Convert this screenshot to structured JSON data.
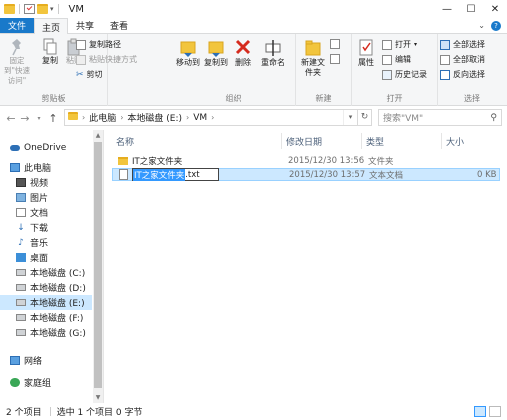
{
  "window": {
    "title": "VM"
  },
  "tabs": [
    {
      "label": "文件"
    },
    {
      "label": "主页"
    },
    {
      "label": "共享"
    },
    {
      "label": "查看"
    }
  ],
  "ribbon": {
    "clipboard": {
      "label": "剪贴板",
      "pin": "固定到\"快速访问\"",
      "copy": "复制",
      "paste": "粘贴",
      "copy_path": "复制路径",
      "paste_shortcut": "粘贴快捷方式",
      "cut": "剪切"
    },
    "organize": {
      "label": "组织",
      "move_to": "移动到",
      "copy_to": "复制到",
      "delete": "删除",
      "rename": "重命名"
    },
    "new": {
      "label": "新建",
      "new_folder": "新建文件夹"
    },
    "open": {
      "label": "打开",
      "properties": "属性",
      "open": "打开",
      "edit": "编辑",
      "history": "历史记录"
    },
    "select": {
      "label": "选择",
      "select_all": "全部选择",
      "select_none": "全部取消",
      "invert": "反向选择"
    }
  },
  "address": {
    "segments": [
      "此电脑",
      "本地磁盘 (E:)",
      "VM"
    ],
    "search_placeholder": "搜索\"VM\""
  },
  "nav": [
    {
      "label": "OneDrive",
      "icon": "cloud-icon"
    },
    {
      "label": "此电脑",
      "icon": "computer-icon"
    },
    {
      "label": "视频",
      "icon": "video-icon"
    },
    {
      "label": "图片",
      "icon": "picture-icon"
    },
    {
      "label": "文档",
      "icon": "document-icon"
    },
    {
      "label": "下载",
      "icon": "download-icon"
    },
    {
      "label": "音乐",
      "icon": "music-icon"
    },
    {
      "label": "桌面",
      "icon": "desktop-icon"
    },
    {
      "label": "本地磁盘 (C:)",
      "icon": "drive-icon"
    },
    {
      "label": "本地磁盘 (D:)",
      "icon": "drive-icon"
    },
    {
      "label": "本地磁盘 (E:)",
      "icon": "drive-icon",
      "selected": true
    },
    {
      "label": "本地磁盘 (F:)",
      "icon": "drive-icon"
    },
    {
      "label": "本地磁盘 (G:)",
      "icon": "drive-icon"
    },
    {
      "label": "网络",
      "icon": "network-icon"
    },
    {
      "label": "家庭组",
      "icon": "homegroup-icon"
    }
  ],
  "columns": {
    "name": "名称",
    "modified": "修改日期",
    "type": "类型",
    "size": "大小"
  },
  "files": [
    {
      "name": "IT之家文件夹",
      "modified": "2015/12/30 13:56",
      "type": "文件夹",
      "size": ""
    },
    {
      "name_selected": "IT之家文件夹",
      "name_rest": ".txt",
      "modified": "2015/12/30 13:57",
      "type": "文本文档",
      "size": "0 KB"
    }
  ],
  "status": {
    "count": "2 个项目",
    "selection": "选中 1 个项目 0 字节"
  },
  "colors": {
    "file_tab": "#1979ca",
    "selection": "#cce8ff",
    "selection_border": "#99d1ff",
    "rename_highlight": "#3399ff",
    "folder": "#f2c53d"
  }
}
